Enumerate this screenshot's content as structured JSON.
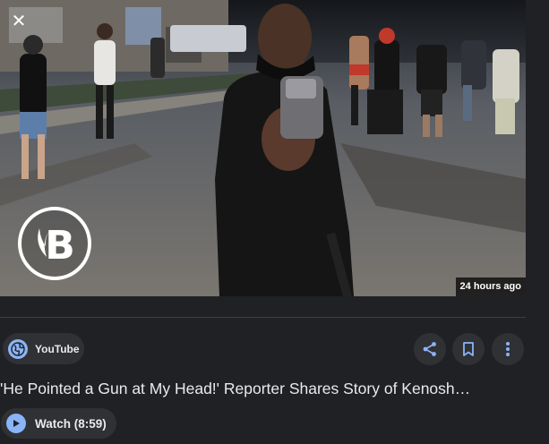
{
  "viewer": {
    "close_icon": "close-icon",
    "close_glyph": "✕",
    "time_badge": "24 hours ago",
    "channel_logo_icon": "channel-logo-icon"
  },
  "source": {
    "name": "YouTube",
    "icon": "globe-icon"
  },
  "actions": {
    "share_icon": "share-icon",
    "save_icon": "bookmark-icon",
    "more_icon": "more-vert-icon"
  },
  "result": {
    "title": "'He Pointed a Gun at My Head!' Reporter Shares Story of Kenosh…"
  },
  "watch": {
    "label": "Watch (8:59)",
    "icon": "play-icon"
  },
  "colors": {
    "background": "#202124",
    "chip": "#303134",
    "accent": "#8ab4f8",
    "text": "#e8eaed"
  }
}
